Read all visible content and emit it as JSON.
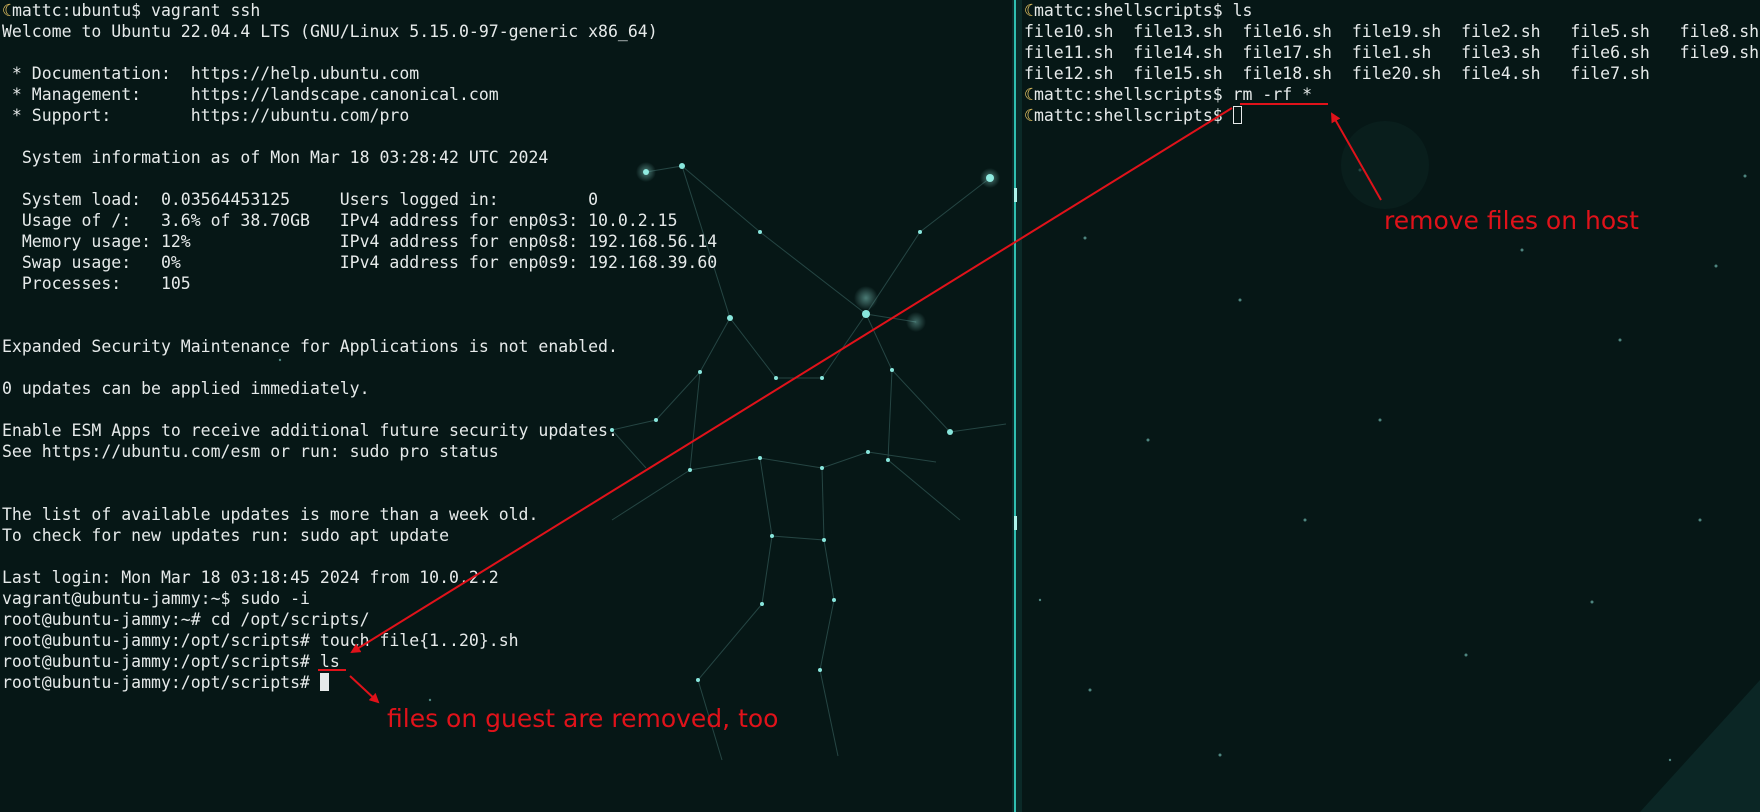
{
  "left_terminal": {
    "lines": [
      {
        "text": "mattc:ubuntu$ vagrant ssh",
        "moon": true
      },
      {
        "text": "Welcome to Ubuntu 22.04.4 LTS (GNU/Linux 5.15.0-97-generic x86_64)"
      },
      {
        "text": ""
      },
      {
        "text": " * Documentation:  https://help.ubuntu.com"
      },
      {
        "text": " * Management:     https://landscape.canonical.com"
      },
      {
        "text": " * Support:        https://ubuntu.com/pro"
      },
      {
        "text": ""
      },
      {
        "text": "  System information as of Mon Mar 18 03:28:42 UTC 2024"
      },
      {
        "text": ""
      },
      {
        "text": "  System load:  0.03564453125     Users logged in:         0"
      },
      {
        "text": "  Usage of /:   3.6% of 38.70GB   IPv4 address for enp0s3: 10.0.2.15"
      },
      {
        "text": "  Memory usage: 12%               IPv4 address for enp0s8: 192.168.56.14"
      },
      {
        "text": "  Swap usage:   0%                IPv4 address for enp0s9: 192.168.39.60"
      },
      {
        "text": "  Processes:    105"
      },
      {
        "text": ""
      },
      {
        "text": ""
      },
      {
        "text": "Expanded Security Maintenance for Applications is not enabled."
      },
      {
        "text": ""
      },
      {
        "text": "0 updates can be applied immediately."
      },
      {
        "text": ""
      },
      {
        "text": "Enable ESM Apps to receive additional future security updates."
      },
      {
        "text": "See https://ubuntu.com/esm or run: sudo pro status"
      },
      {
        "text": ""
      },
      {
        "text": ""
      },
      {
        "text": "The list of available updates is more than a week old."
      },
      {
        "text": "To check for new updates run: sudo apt update"
      },
      {
        "text": ""
      },
      {
        "text": "Last login: Mon Mar 18 03:18:45 2024 from 10.0.2.2"
      },
      {
        "text": "vagrant@ubuntu-jammy:~$ sudo -i"
      },
      {
        "text": "root@ubuntu-jammy:~# cd /opt/scripts/"
      },
      {
        "text": "root@ubuntu-jammy:/opt/scripts# touch file{1..20}.sh"
      },
      {
        "text": "root@ubuntu-jammy:/opt/scripts# ls"
      },
      {
        "text": "root@ubuntu-jammy:/opt/scripts# ",
        "cursor": "block"
      }
    ]
  },
  "right_terminal": {
    "lines": [
      {
        "text": "mattc:shellscripts$ ls",
        "moon": true
      },
      {
        "text": "file10.sh  file13.sh  file16.sh  file19.sh  file2.sh   file5.sh   file8.sh"
      },
      {
        "text": "file11.sh  file14.sh  file17.sh  file1.sh   file3.sh   file6.sh   file9.sh"
      },
      {
        "text": "file12.sh  file15.sh  file18.sh  file20.sh  file4.sh   file7.sh"
      },
      {
        "text": "mattc:shellscripts$ rm -rf *",
        "moon": true
      },
      {
        "text": "mattc:shellscripts$ ",
        "moon": true,
        "cursor": "outline"
      }
    ]
  },
  "annotations": {
    "host_note": "remove files on host",
    "guest_note": "files on guest are removed, too",
    "color": "#e0121a"
  },
  "colors": {
    "background": "#061716",
    "terminal_text": "#e6eaea",
    "divider": "#2fbfb0",
    "prompt_icon": "#ffd76a"
  },
  "icons": {
    "prompt_icon": "moon-icon"
  }
}
